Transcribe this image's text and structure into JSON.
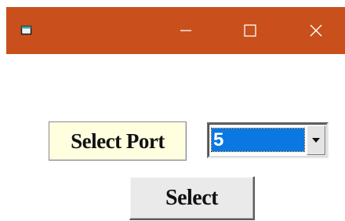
{
  "window": {
    "title": "",
    "titlebar_color": "#c9501c",
    "controls": {
      "minimize_icon": "minimize-icon",
      "maximize_icon": "maximize-icon",
      "close_icon": "close-icon"
    }
  },
  "form": {
    "port_label": "Select Port",
    "port_combo": {
      "selected_value": "5",
      "highlight_color": "#0a78e0"
    },
    "select_button_label": "Select"
  }
}
